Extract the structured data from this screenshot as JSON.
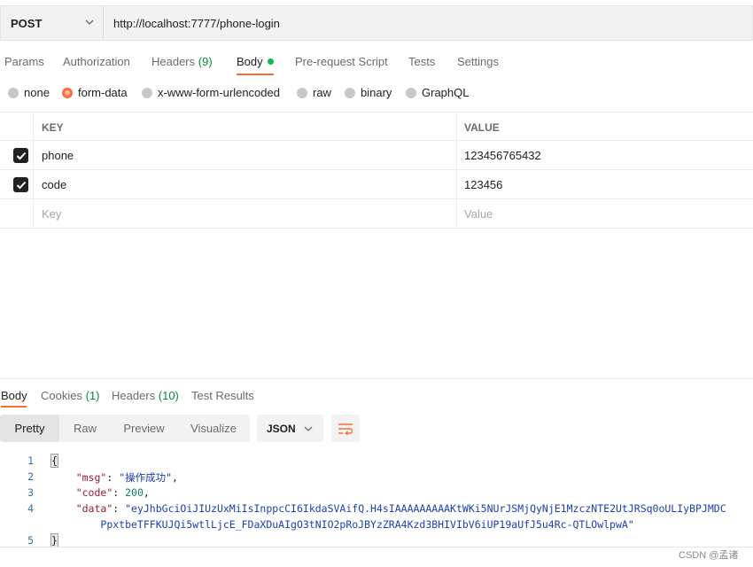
{
  "request": {
    "method": "POST",
    "url": "http://localhost:7777/phone-login"
  },
  "request_tabs": [
    {
      "label": "Params"
    },
    {
      "label": "Authorization"
    },
    {
      "label": "Headers",
      "count": "(9)"
    },
    {
      "label": "Body",
      "active": true
    },
    {
      "label": "Pre-request Script"
    },
    {
      "label": "Tests"
    },
    {
      "label": "Settings"
    }
  ],
  "body_types": [
    {
      "label": "none"
    },
    {
      "label": "form-data",
      "selected": true
    },
    {
      "label": "x-www-form-urlencoded"
    },
    {
      "label": "raw"
    },
    {
      "label": "binary"
    },
    {
      "label": "GraphQL"
    }
  ],
  "kv_table": {
    "headers": {
      "key": "KEY",
      "value": "VALUE"
    },
    "rows": [
      {
        "key": "phone",
        "value": "123456765432",
        "checked": true
      },
      {
        "key": "code",
        "value": "123456",
        "checked": true
      }
    ],
    "placeholder": {
      "key": "Key",
      "value": "Value"
    }
  },
  "response_tabs": [
    {
      "label": "Body",
      "active": true
    },
    {
      "label": "Cookies",
      "count": "(1)"
    },
    {
      "label": "Headers",
      "count": "(10)"
    },
    {
      "label": "Test Results"
    }
  ],
  "view_modes": [
    "Pretty",
    "Raw",
    "Preview",
    "Visualize"
  ],
  "format": "JSON",
  "response_lines": [
    {
      "num": "1",
      "open": "{"
    },
    {
      "num": "2",
      "key": "\"msg\"",
      "value": "\"操作成功\"",
      "vtype": "s",
      "tail": ","
    },
    {
      "num": "3",
      "key": "\"code\"",
      "value": "200",
      "vtype": "n",
      "tail": ","
    },
    {
      "num": "4",
      "key": "\"data\"",
      "value": "\"eyJhbGciOiJIUzUxMiIsInppcCI6IkdaSVAifQ.H4sIAAAAAAAAAKtWKi5NUrJSMjQyNjE1MzczNTE2UtJRSq0oULIyBPJMDC",
      "vtype": "s"
    },
    {
      "cont": "PpxtbeTFFKUJQi5wtlLjcE_FDaXDuAIgO3tNIO2pRoJBYzZRA4Kzd3BHIVIbV6iUP19aUfJ5u4Rc-QTLOwlpwA\""
    },
    {
      "num": "5",
      "close": "}"
    }
  ],
  "watermark": "CSDN @孟诸",
  "colors": {
    "accent": "#ff6c37",
    "body_dot": "#0cbb52",
    "count": "#0a8a3a"
  }
}
